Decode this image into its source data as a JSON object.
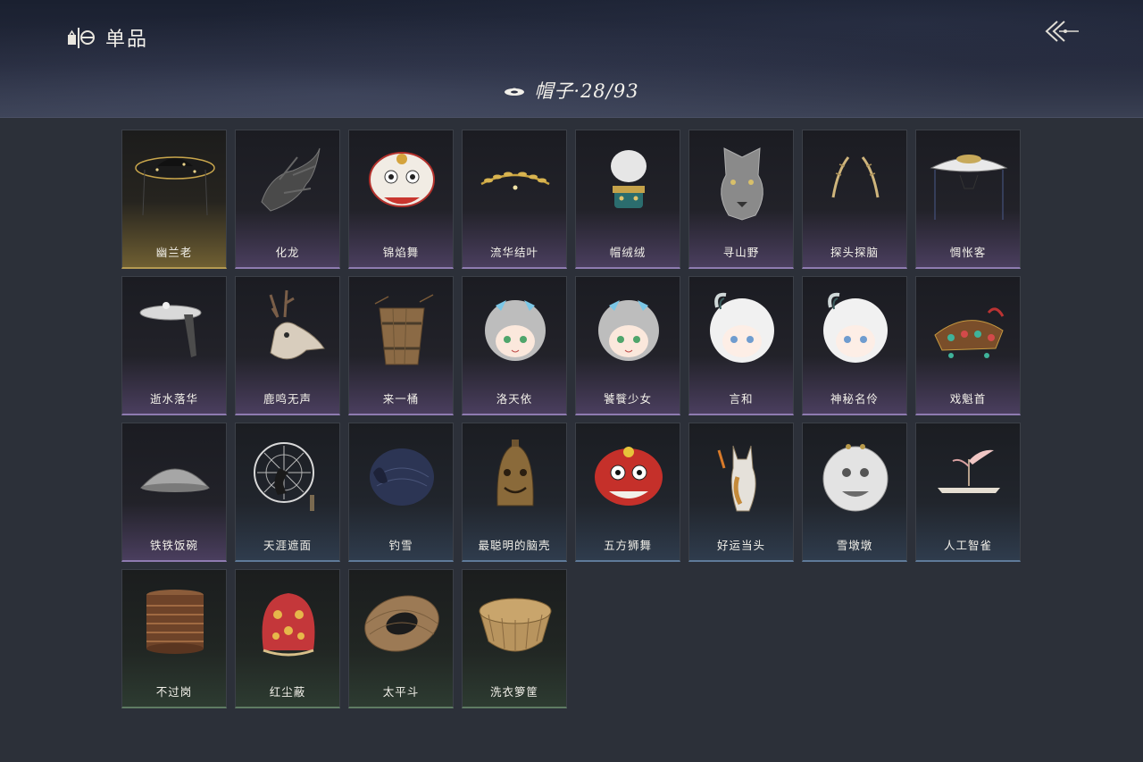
{
  "header": {
    "title": "单品",
    "title_icon": "wardrobe-icon",
    "back_icon": "double-chevron-left-icon"
  },
  "category": {
    "label": "帽子·28/93",
    "icon": "hat-icon"
  },
  "rarity_colors": {
    "gold": "#b49a52",
    "purple": "#8e7bb0",
    "blue": "#5f7a99",
    "green": "#5e7b63"
  },
  "items": [
    {
      "name": "幽兰老",
      "rarity": "gold",
      "icon": "straw-hat-with-veil-icon"
    },
    {
      "name": "化龙",
      "rarity": "purple",
      "icon": "dragon-head-icon"
    },
    {
      "name": "锦焰舞",
      "rarity": "purple",
      "icon": "lion-dance-head-icon"
    },
    {
      "name": "流华结叶",
      "rarity": "purple",
      "icon": "golden-laurel-icon"
    },
    {
      "name": "帽绒绒",
      "rarity": "purple",
      "icon": "fur-crown-icon"
    },
    {
      "name": "寻山野",
      "rarity": "purple",
      "icon": "wolf-head-icon"
    },
    {
      "name": "探头探脑",
      "rarity": "purple",
      "icon": "feather-antenna-icon"
    },
    {
      "name": "惆怅客",
      "rarity": "purple",
      "icon": "white-bamboo-hat-icon"
    },
    {
      "name": "逝水落华",
      "rarity": "purple",
      "icon": "veiled-hat-icon"
    },
    {
      "name": "鹿鸣无声",
      "rarity": "purple",
      "icon": "deer-skull-icon"
    },
    {
      "name": "来一桶",
      "rarity": "purple",
      "icon": "wooden-bucket-icon"
    },
    {
      "name": "洛天依",
      "rarity": "purple",
      "icon": "anime-girl-head-icon"
    },
    {
      "name": "饕餮少女",
      "rarity": "purple",
      "icon": "anime-girl-head-icon"
    },
    {
      "name": "言和",
      "rarity": "purple",
      "icon": "white-hair-head-icon"
    },
    {
      "name": "神秘名伶",
      "rarity": "purple",
      "icon": "white-hair-head-icon"
    },
    {
      "name": "戏魁首",
      "rarity": "purple",
      "icon": "opera-crown-icon"
    },
    {
      "name": "铁铁饭碗",
      "rarity": "purple",
      "icon": "iron-bowl-icon"
    },
    {
      "name": "天涯遮面",
      "rarity": "blue",
      "icon": "broken-hat-frame-icon"
    },
    {
      "name": "钓雪",
      "rarity": "blue",
      "icon": "dark-round-hat-icon"
    },
    {
      "name": "最聪明的脑壳",
      "rarity": "blue",
      "icon": "bell-helmet-icon"
    },
    {
      "name": "五方狮舞",
      "rarity": "blue",
      "icon": "red-lion-head-icon"
    },
    {
      "name": "好运当头",
      "rarity": "blue",
      "icon": "horse-head-icon"
    },
    {
      "name": "雪墩墩",
      "rarity": "blue",
      "icon": "stone-lion-head-icon"
    },
    {
      "name": "人工智雀",
      "rarity": "blue",
      "icon": "bird-hat-icon"
    },
    {
      "name": "不过岗",
      "rarity": "green",
      "icon": "stacked-bowls-icon"
    },
    {
      "name": "红尘蔽",
      "rarity": "green",
      "icon": "red-hood-icon"
    },
    {
      "name": "太平斗",
      "rarity": "green",
      "icon": "woven-basket-hat-icon"
    },
    {
      "name": "洗衣箩筐",
      "rarity": "green",
      "icon": "woven-basket-icon"
    }
  ]
}
